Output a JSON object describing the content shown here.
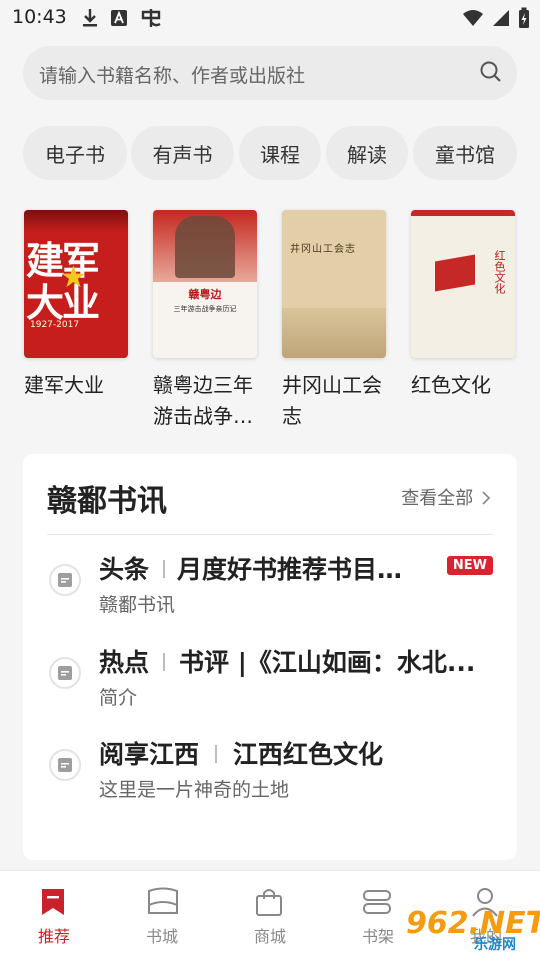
{
  "status_bar": {
    "time": "10:43"
  },
  "search": {
    "placeholder": "请输入书籍名称、作者或出版社"
  },
  "categories": [
    "电子书",
    "有声书",
    "课程",
    "解读",
    "童书馆"
  ],
  "books": [
    {
      "title": "建军大业",
      "cover_text": [
        "建军",
        "大业",
        "1927-2017"
      ]
    },
    {
      "title": "赣粤边三年游击战争…",
      "cover_text": [
        "赣粤边",
        "三年游击战争亲历记"
      ]
    },
    {
      "title": "井冈山工会志",
      "cover_text": [
        "井冈山工会志"
      ]
    },
    {
      "title": "红色文化",
      "cover_text": [
        "红色文化"
      ]
    }
  ],
  "news": {
    "heading": "赣鄱书讯",
    "more_label": "查看全部",
    "items": [
      {
        "tag": "头条",
        "title": "月度好书推荐书目（...",
        "sub": "赣鄱书讯",
        "badge": "NEW"
      },
      {
        "tag": "热点",
        "title": "书评 |《江山如画：水北...",
        "sub": "简介"
      },
      {
        "tag": "阅享江西",
        "title": "江西红色文化",
        "sub": "这里是一片神奇的土地"
      }
    ]
  },
  "nav": [
    {
      "label": "推荐",
      "icon": "bookmark-icon",
      "active": true
    },
    {
      "label": "书城",
      "icon": "bookstore-icon"
    },
    {
      "label": "商城",
      "icon": "shopping-bag-icon"
    },
    {
      "label": "书架",
      "icon": "bookshelf-icon"
    },
    {
      "label": "我的",
      "icon": "user-icon"
    }
  ],
  "watermark": {
    "text": "962.NET",
    "sub": "乐游网"
  },
  "colors": {
    "accent": "#c8232c",
    "badge": "#d9232e",
    "background": "#f5f5f5"
  }
}
